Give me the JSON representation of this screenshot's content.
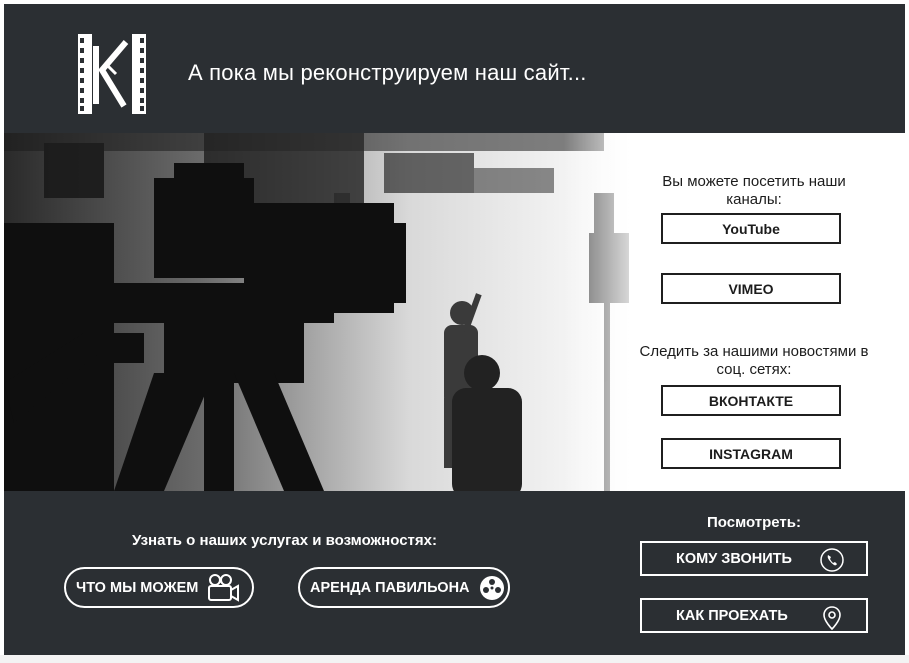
{
  "header": {
    "tagline": "А пока мы реконструируем наш сайт..."
  },
  "channels": {
    "heading": "Вы можете посетить наши каналы:",
    "buttons": [
      "YouTube",
      "VIMEO"
    ]
  },
  "social": {
    "heading": "Следить за нашими новостями в соц. сетях:",
    "buttons": [
      "ВКОНТАКТЕ",
      "INSTAGRAM"
    ]
  },
  "services": {
    "heading": "Узнать о наших услугах и возможностях:",
    "what_we_can": "ЧТО МЫ МОЖЕМ",
    "rent": "АРЕНДА ПАВИЛЬОНА"
  },
  "see": {
    "heading": "Посмотреть:",
    "call": "КОМУ ЗВОНИТЬ",
    "directions": "КАК ПРОЕХАТЬ"
  },
  "colors": {
    "background": "#2b2f33",
    "text_light": "#ffffff",
    "text_dark": "#1c1c1c"
  },
  "icons": {
    "logo": "film-strip-k-logo",
    "what_we_can": "video-camera-icon",
    "rent": "film-reel-icon",
    "call": "phone-icon",
    "directions": "map-pin-icon"
  }
}
